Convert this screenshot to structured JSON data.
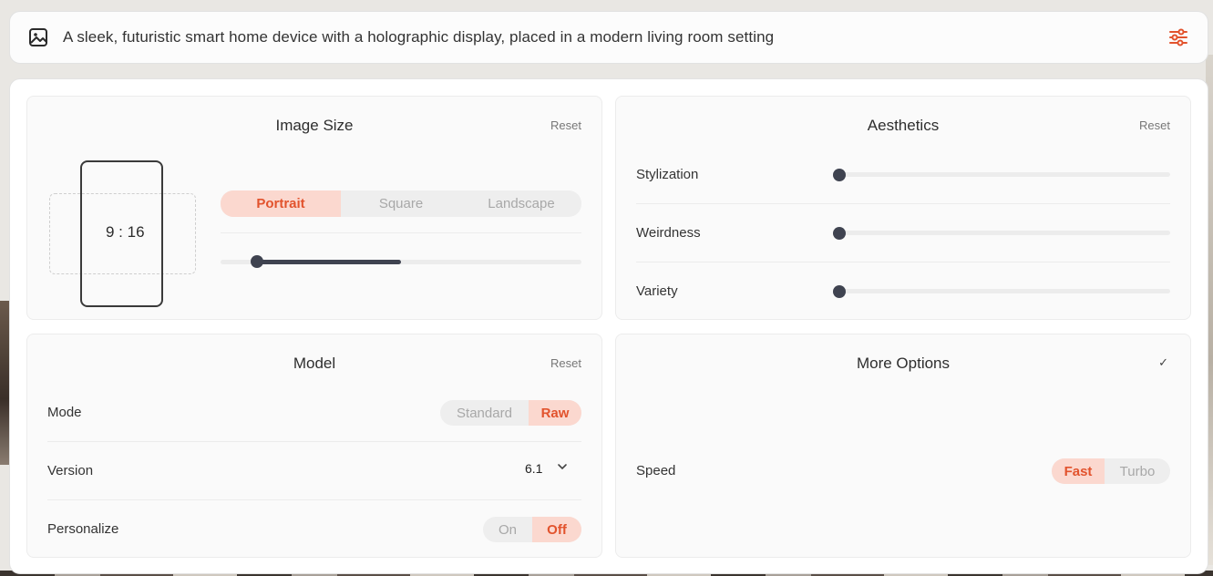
{
  "prompt": {
    "text": "A sleek, futuristic smart home device with a holographic display, placed in a modern living room setting",
    "image_icon": "image-icon",
    "settings_icon": "sliders-icon",
    "accent_color": "#e2532d"
  },
  "image_size": {
    "title": "Image Size",
    "reset": "Reset",
    "ratio": "9 : 16",
    "orientation_options": [
      "Portrait",
      "Square",
      "Landscape"
    ],
    "selected_orientation": "Portrait",
    "ratio_slider_value": 0.5
  },
  "aesthetics": {
    "title": "Aesthetics",
    "reset": "Reset",
    "rows": [
      {
        "label": "Stylization",
        "value": 0
      },
      {
        "label": "Weirdness",
        "value": 0
      },
      {
        "label": "Variety",
        "value": 0
      }
    ]
  },
  "model": {
    "title": "Model",
    "reset": "Reset",
    "mode_label": "Mode",
    "mode_options": [
      "Standard",
      "Raw"
    ],
    "mode_selected": "Raw",
    "version_label": "Version",
    "version_value": "6.1",
    "personalize_label": "Personalize",
    "personalize_options": [
      "On",
      "Off"
    ],
    "personalize_selected": "Off"
  },
  "more_options": {
    "title": "More Options",
    "check": "✓",
    "speed_label": "Speed",
    "speed_options": [
      "Fast",
      "Turbo"
    ],
    "speed_selected": "Fast"
  }
}
